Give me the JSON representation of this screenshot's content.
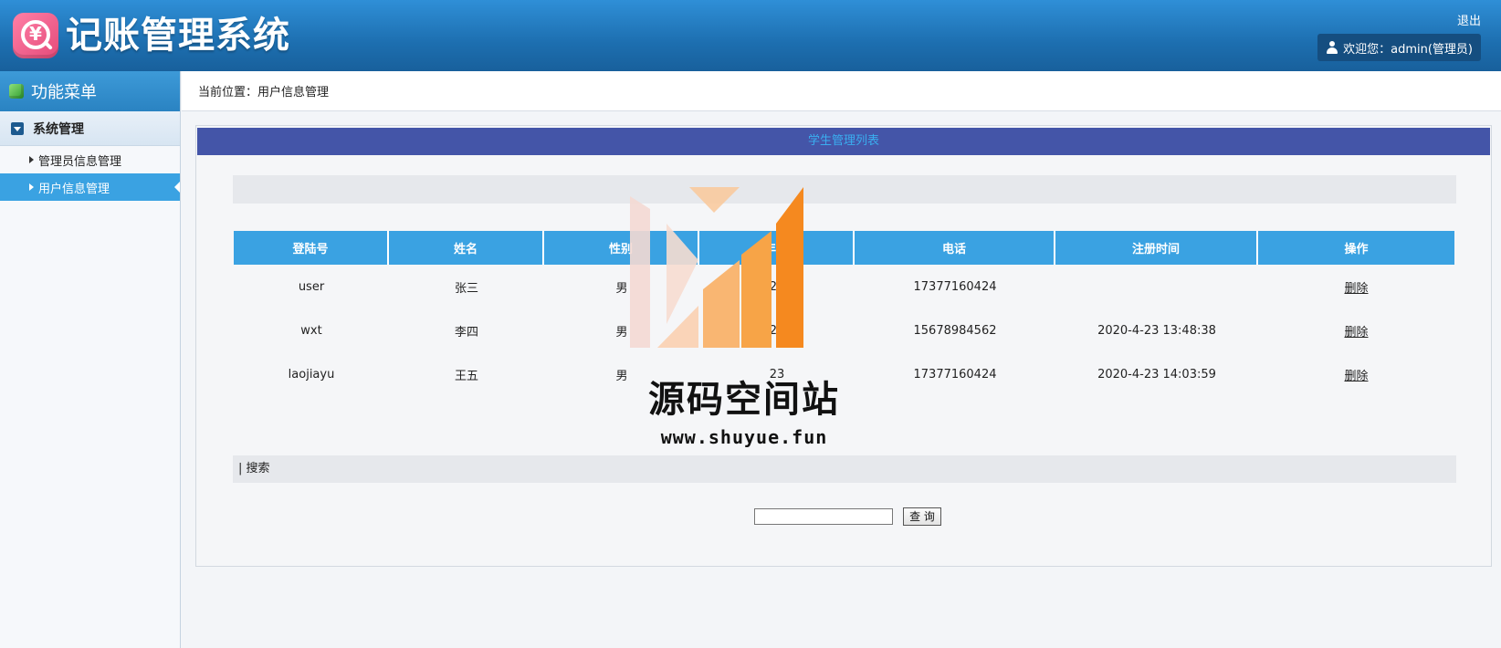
{
  "header": {
    "app_title": "记账管理系统",
    "logo_symbol": "¥",
    "logout_label": "退出",
    "welcome_text": "欢迎您：admin(管理员)"
  },
  "sidebar": {
    "menu_title": "功能菜单",
    "group_label": "系统管理",
    "items": [
      {
        "label": "管理员信息管理",
        "active": false
      },
      {
        "label": "用户信息管理",
        "active": true
      }
    ]
  },
  "breadcrumb": {
    "text": "当前位置：用户信息管理"
  },
  "panel": {
    "title": "学生管理列表",
    "columns": [
      "登陆号",
      "姓名",
      "性别",
      "年龄",
      "电话",
      "注册时间",
      "操作"
    ],
    "rows": [
      {
        "login": "user",
        "name": "张三",
        "gender": "男",
        "age": "23",
        "phone": "17377160424",
        "reg_time": "",
        "action": "删除"
      },
      {
        "login": "wxt",
        "name": "李四",
        "gender": "男",
        "age": "20",
        "phone": "15678984562",
        "reg_time": "2020-4-23 13:48:38",
        "action": "删除"
      },
      {
        "login": "laojiayu",
        "name": "王五",
        "gender": "男",
        "age": "23",
        "phone": "17377160424",
        "reg_time": "2020-4-23 14:03:59",
        "action": "删除"
      }
    ],
    "search_bar_label": "| 搜索",
    "search_input_value": "",
    "query_button_label": "查 询"
  },
  "watermark": {
    "name": "源码空间站",
    "url": "www.shuyue.fun"
  },
  "colors": {
    "header_blue": "#1d6fb0",
    "accent_blue": "#3aa2e2",
    "panel_title_bg": "#4455a8",
    "watermark_orange": "#f5891f"
  }
}
